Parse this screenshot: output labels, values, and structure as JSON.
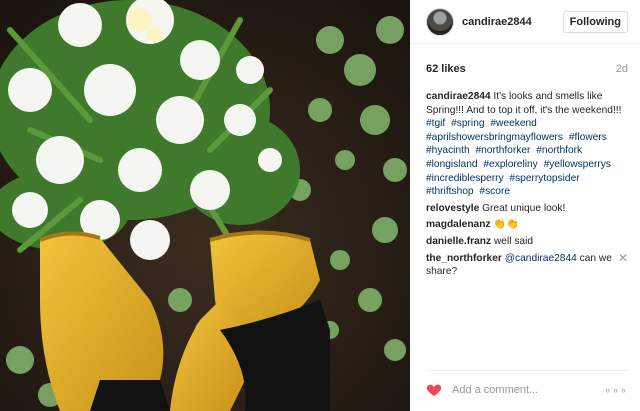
{
  "post": {
    "username": "candirae2844",
    "follow_label": "Following",
    "likes": "62 likes",
    "age": "2d"
  },
  "caption": {
    "user": "candirae2844",
    "text": "It's looks and smells like Spring!!! And to top it off, it's the weekend!!!",
    "hashtags": [
      "#tgif",
      "#spring",
      "#weekend",
      "#aprilshowersbringmayflowers",
      "#flowers",
      "#hyacinth",
      "#northforker",
      "#northfork",
      "#longisland",
      "#exploreliny",
      "#yellowsperrys",
      "#incrediblesperry",
      "#sperrytopsider",
      "#thriftshop",
      "#score"
    ]
  },
  "comments": [
    {
      "user": "relovestyle",
      "text": "Great unique look!"
    },
    {
      "user": "magdalenanz",
      "text": "👏👏"
    },
    {
      "user": "danielle.franz",
      "text": "well said"
    },
    {
      "user": "the_northforker",
      "mention": "@candirae2844",
      "text": "can we share?"
    }
  ],
  "footer": {
    "add_comment_placeholder": "Add a comment...",
    "more_label": "∘∘∘"
  },
  "colors": {
    "hashtag": "#003569",
    "heart": "#ed4956",
    "boot": "#e8b320"
  }
}
